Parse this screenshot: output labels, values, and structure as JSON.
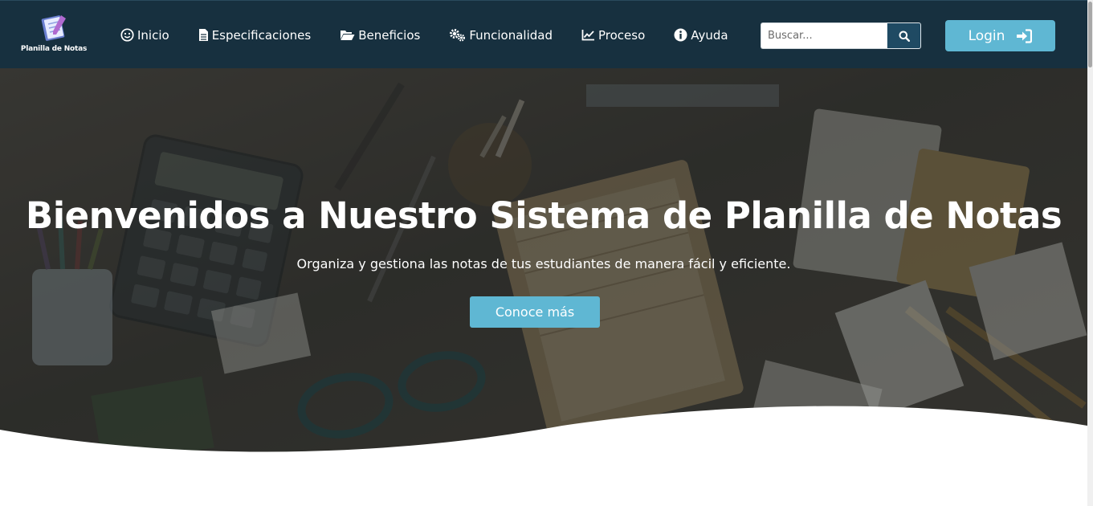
{
  "brand": {
    "name": "Planilla de Notas",
    "logo_icon": "notebook-pen-icon"
  },
  "nav": {
    "items": [
      {
        "label": "Inicio",
        "icon": "smile-icon"
      },
      {
        "label": "Especificaciones",
        "icon": "file-icon"
      },
      {
        "label": "Beneficios",
        "icon": "folder-open-icon"
      },
      {
        "label": "Funcionalidad",
        "icon": "gears-icon"
      },
      {
        "label": "Proceso",
        "icon": "line-chart-icon"
      },
      {
        "label": "Ayuda",
        "icon": "info-circle-icon"
      }
    ]
  },
  "search": {
    "placeholder": "Buscar...",
    "value": "",
    "icon": "search-icon"
  },
  "login": {
    "label": "Login",
    "icon": "sign-in-icon"
  },
  "hero": {
    "title": "Bienvenidos a Nuestro Sistema de Planilla de Notas",
    "subtitle": "Organiza y gestiona las notas de tus estudiantes de manera fácil y eficiente.",
    "cta_label": "Conoce más"
  },
  "colors": {
    "navbar_bg": "#17303f",
    "accent": "#5fb7d3",
    "search_button": "#1f4a63",
    "hero_bg": "#3f3d38"
  }
}
